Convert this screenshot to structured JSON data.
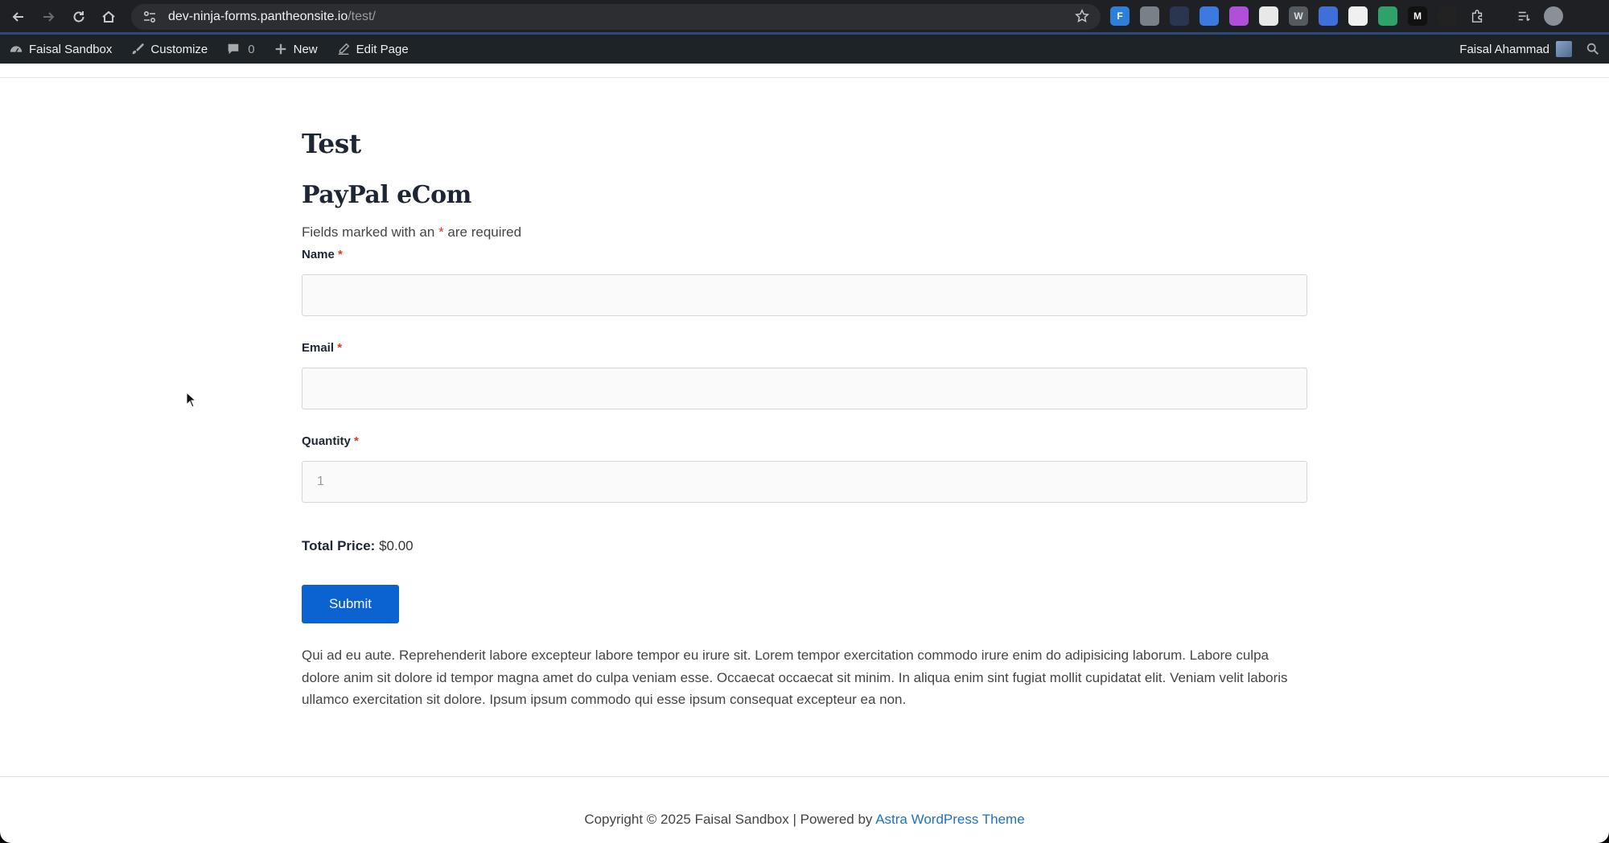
{
  "browser": {
    "url_host": "dev-ninja-forms.pantheonsite.io",
    "url_path": "/test/",
    "extensions": [
      {
        "icon": "ninja-forms-ext-icon",
        "label": "F",
        "color": "#2e7fd9"
      },
      {
        "icon": "shield-ext-icon",
        "label": "",
        "color": "#7a8088"
      },
      {
        "icon": "arrow-ext-icon",
        "label": "",
        "color": "#2a3550"
      },
      {
        "icon": "circle-ext-icon",
        "label": "",
        "color": "#3b7be0"
      },
      {
        "icon": "purple-ext-icon",
        "label": "",
        "color": "#b04fd8"
      },
      {
        "icon": "notes-ext-icon",
        "label": "",
        "color": "#e8e8e8"
      },
      {
        "icon": "wordpress-ext-icon",
        "label": "W",
        "color": "#555a60"
      },
      {
        "icon": "translate-ext-icon",
        "label": "",
        "color": "#3f6fd8"
      },
      {
        "icon": "password-ext-icon",
        "label": "",
        "color": "#f0f0f0"
      },
      {
        "icon": "screen-ext-icon",
        "label": "",
        "color": "#2fa26a"
      },
      {
        "icon": "m-ext-icon",
        "label": "M",
        "color": "#111111"
      },
      {
        "icon": "dark-ext-icon",
        "label": "",
        "color": "#222222"
      },
      {
        "icon": "puzzle-ext-icon",
        "label": "",
        "color": "#1f2023"
      },
      {
        "icon": "queue-ext-icon",
        "label": "",
        "color": "#1f2023"
      },
      {
        "icon": "profile-avatar-icon",
        "label": "",
        "color": "#8a8f98"
      }
    ]
  },
  "admin_bar": {
    "site_name": "Faisal Sandbox",
    "customize": "Customize",
    "comments_count": "0",
    "new": "New",
    "edit_page": "Edit Page",
    "user_name": "Faisal Ahammad"
  },
  "page": {
    "title": "Test",
    "form_title": "PayPal eCom",
    "required_note_before": "Fields marked with an ",
    "required_star": "*",
    "required_note_after": " are required",
    "fields": {
      "name_label": "Name",
      "email_label": "Email",
      "quantity_label": "Quantity",
      "quantity_placeholder": "1",
      "star": "*"
    },
    "total_label": "Total Price:",
    "total_value": "$0.00",
    "submit_label": "Submit",
    "body_text": "Qui ad eu aute. Reprehenderit labore excepteur labore tempor eu irure sit. Lorem tempor exercitation commodo irure enim do adipisicing laborum. Labore culpa dolore anim sit dolore id tempor magna amet do culpa veniam esse. Occaecat occaecat sit minim. In aliqua enim sint fugiat mollit cupidatat elit. Veniam velit laboris ullamco exercitation sit dolore. Ipsum ipsum commodo qui esse ipsum consequat excepteur ea non."
  },
  "footer": {
    "copyright": "Copyright © 2025 Faisal Sandbox | Powered by ",
    "theme_link": "Astra WordPress Theme"
  }
}
